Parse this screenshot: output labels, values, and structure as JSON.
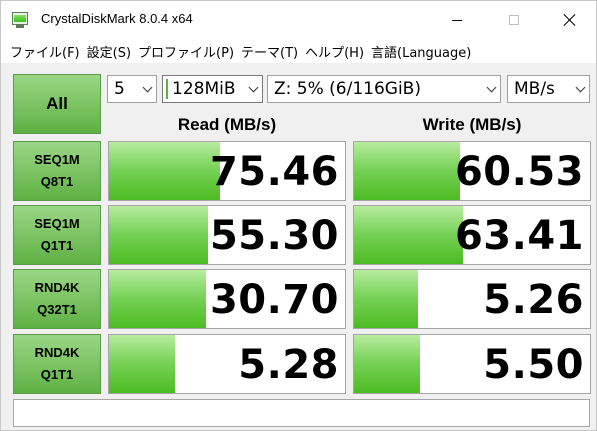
{
  "window": {
    "title": "CrystalDiskMark 8.0.4 x64"
  },
  "menu": [
    "ファイル(F)",
    "設定(S)",
    "プロファイル(P)",
    "テーマ(T)",
    "ヘルプ(H)",
    "言語(Language)"
  ],
  "controls": {
    "all_label": "All",
    "test_count": "5",
    "test_size": "128MiB",
    "drive": "Z: 5% (6/116GiB)",
    "unit": "MB/s"
  },
  "headers": {
    "read": "Read (MB/s)",
    "write": "Write (MB/s)"
  },
  "results": [
    {
      "line1": "SEQ1M",
      "line2": "Q8T1",
      "read": "75.46",
      "write": "60.53",
      "read_fill": 0.47,
      "write_fill": 0.45
    },
    {
      "line1": "SEQ1M",
      "line2": "Q1T1",
      "read": "55.30",
      "write": "63.41",
      "read_fill": 0.42,
      "write_fill": 0.46
    },
    {
      "line1": "RND4K",
      "line2": "Q32T1",
      "read": "30.70",
      "write": "5.26",
      "read_fill": 0.41,
      "write_fill": 0.27
    },
    {
      "line1": "RND4K",
      "line2": "Q1T1",
      "read": "5.28",
      "write": "5.50",
      "read_fill": 0.28,
      "write_fill": 0.28
    }
  ],
  "status": ""
}
